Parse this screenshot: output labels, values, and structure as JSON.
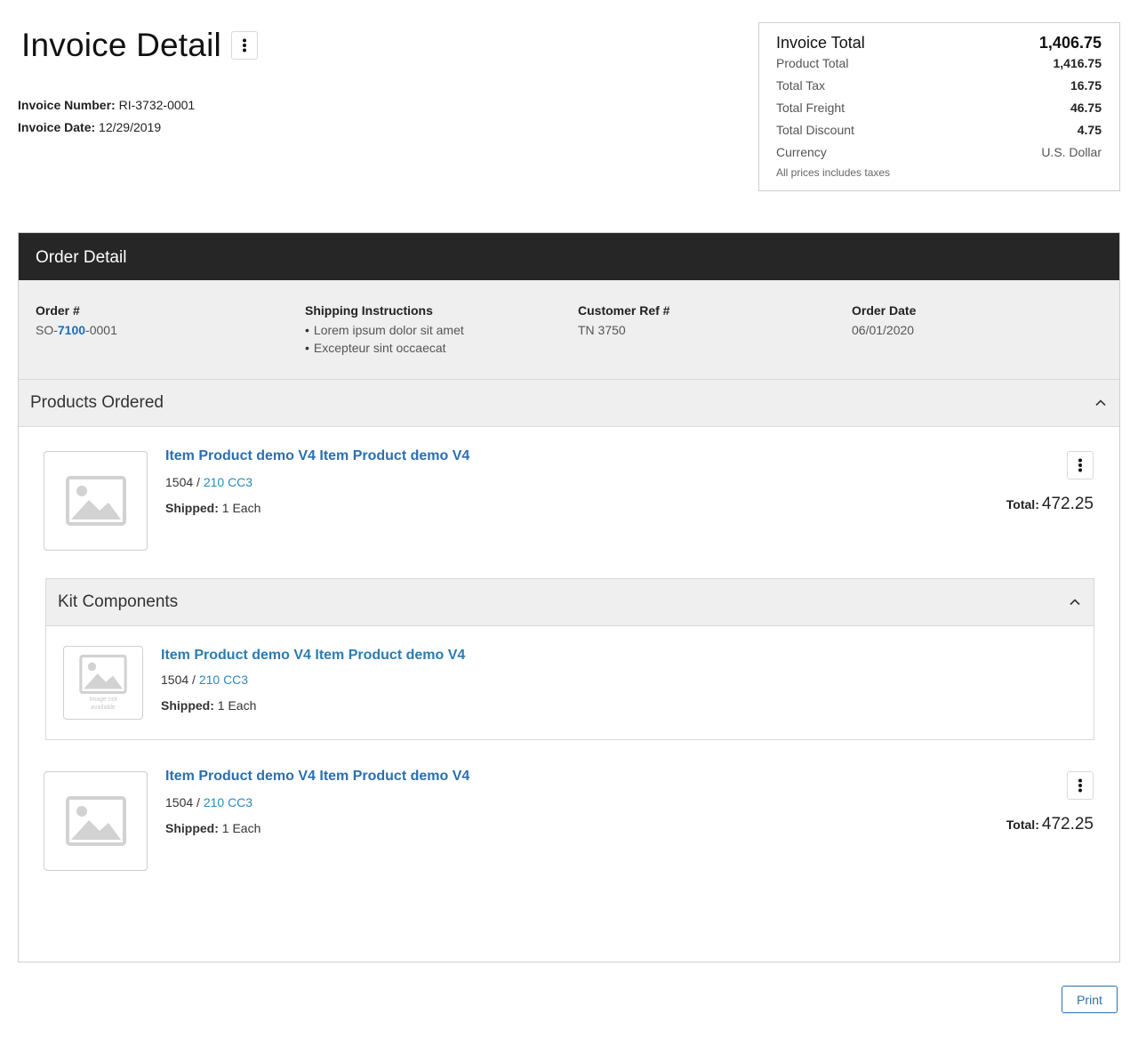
{
  "header": {
    "title": "Invoice Detail",
    "invoice_number_label": "Invoice Number:",
    "invoice_number": "RI-3732-0001",
    "invoice_date_label": "Invoice Date:",
    "invoice_date": "12/29/2019"
  },
  "totals": {
    "title": "Invoice Total",
    "total": "1,406.75",
    "rows": [
      {
        "label": "Product Total",
        "value": "1,416.75"
      },
      {
        "label": "Total Tax",
        "value": "16.75"
      },
      {
        "label": "Total Freight",
        "value": "46.75"
      },
      {
        "label": "Total Discount",
        "value": "4.75"
      },
      {
        "label": "Currency",
        "value": "U.S. Dollar"
      }
    ],
    "note": "All prices includes taxes"
  },
  "order": {
    "header": "Order Detail",
    "order_label": "Order #",
    "order_prefix": "SO-",
    "order_highlight": "7100",
    "order_suffix": "-0001",
    "shipping_label": "Shipping Instructions",
    "shipping_items": [
      "Lorem ipsum dolor sit amet",
      "Excepteur sint occaecat"
    ],
    "customer_ref_label": "Customer Ref #",
    "customer_ref": "TN 3750",
    "order_date_label": "Order Date",
    "order_date": "06/01/2020"
  },
  "products_section": {
    "title": "Products Ordered",
    "items": [
      {
        "name": "Item Product demo V4 Item Product demo V4",
        "sku_prefix": "1504 / ",
        "sku_link": "210 CC3",
        "shipped_label": "Shipped:",
        "shipped_value": "1 Each",
        "total_label": "Total:",
        "total_value": "472.25"
      },
      {
        "name": "Item Product demo V4 Item Product demo V4",
        "sku_prefix": "1504 / ",
        "sku_link": "210 CC3",
        "shipped_label": "Shipped:",
        "shipped_value": "1 Each",
        "total_label": "Total:",
        "total_value": "472.25"
      }
    ]
  },
  "kit_section": {
    "title": "Kit Components",
    "item": {
      "name": "Item Product demo V4 Item Product demo V4",
      "sku_prefix": "1504 / ",
      "sku_link": "210 CC3",
      "shipped_label": "Shipped:",
      "shipped_value": "1 Each",
      "image_text": "Image not available"
    }
  },
  "footer": {
    "print_label": "Print"
  },
  "icons": {
    "kebab": "more-vertical-icon",
    "chevron": "chevron-up-icon",
    "image": "image-placeholder-icon"
  },
  "colors": {
    "link": "#2b6fb0",
    "header_bg": "#262626",
    "panel_bg": "#efefef"
  }
}
